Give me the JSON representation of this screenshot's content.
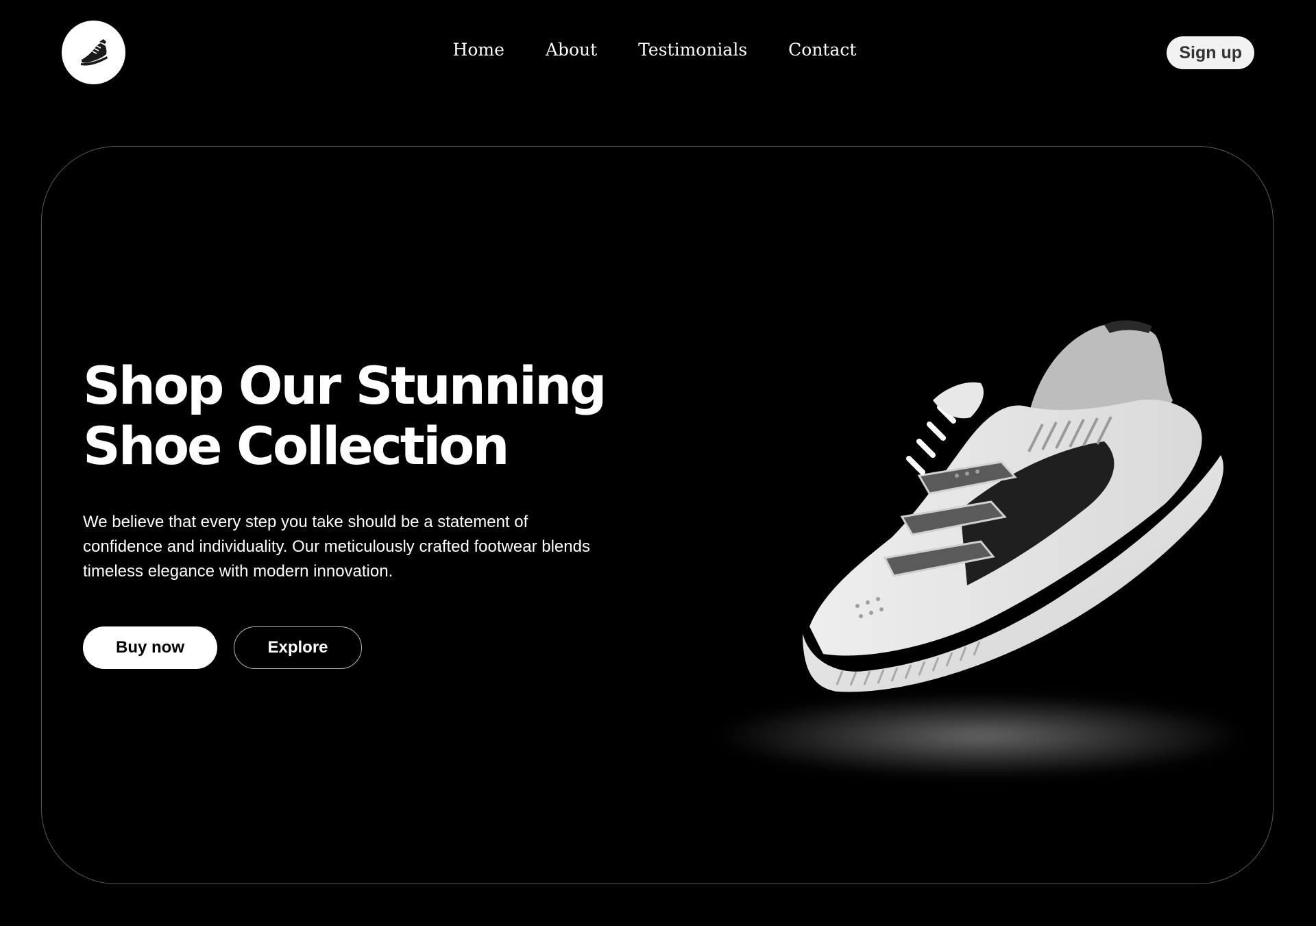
{
  "header": {
    "logo_icon": "sneaker-icon",
    "nav": [
      {
        "label": "Home"
      },
      {
        "label": "About"
      },
      {
        "label": "Testimonials"
      },
      {
        "label": "Contact"
      }
    ],
    "signup_label": "Sign up"
  },
  "hero": {
    "headline_line1": "Shop Our Stunning",
    "headline_line2": "Shoe Collection",
    "description": "We believe that every step you take should be a statement of confidence and individuality. Our meticulously crafted footwear blends timeless elegance with modern innovation.",
    "buy_label": "Buy now",
    "explore_label": "Explore",
    "image_icon": "sneaker-image"
  },
  "colors": {
    "background": "#000000",
    "text": "#ffffff",
    "card_border": "#5a5a5a",
    "signup_bg": "#f2f2f2"
  }
}
